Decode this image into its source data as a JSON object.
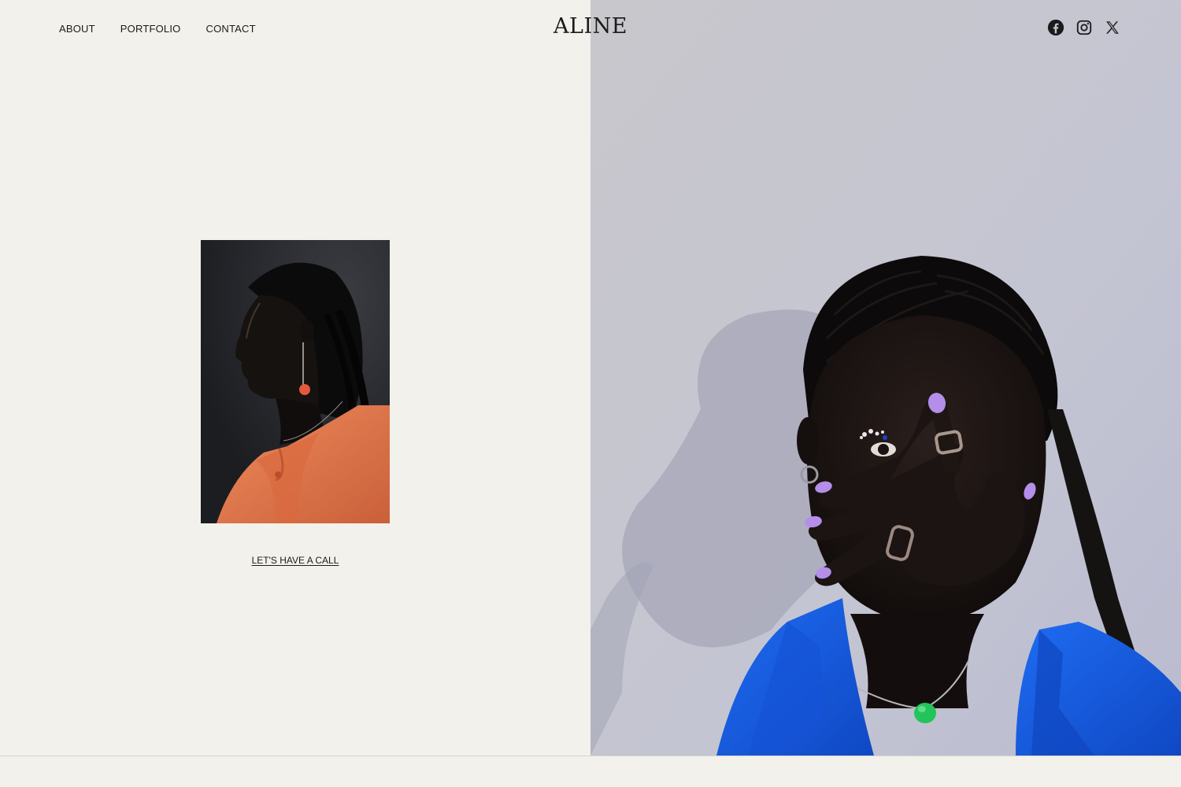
{
  "nav": {
    "about": "ABOUT",
    "portfolio": "PORTFOLIO",
    "contact": "CONTACT"
  },
  "brand": {
    "logo": "ALINE"
  },
  "social": {
    "icons": [
      "facebook-icon",
      "instagram-icon",
      "x-icon"
    ]
  },
  "hero": {
    "cta_label": "LET'S HAVE A CALL"
  },
  "colors": {
    "background": "#f3f1ec",
    "text": "#1b1b1b",
    "jacket_blue": "#1a5ee0",
    "nail_lilac": "#b48ee8",
    "garment_orange": "#e27a4a"
  }
}
